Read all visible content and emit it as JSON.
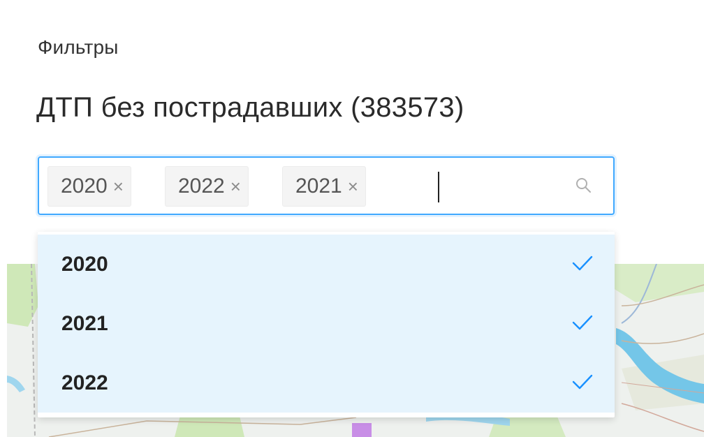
{
  "filters": {
    "title": "Фильтры",
    "layer_title": "ДТП без пострадавших (383573)"
  },
  "select": {
    "tags": [
      {
        "label": "2020",
        "close": "×"
      },
      {
        "label": "2022",
        "close": "×"
      },
      {
        "label": "2021",
        "close": "×"
      }
    ],
    "search_icon": "search-icon"
  },
  "dropdown": {
    "options": [
      {
        "label": "2020",
        "selected": true,
        "icon": "check-icon"
      },
      {
        "label": "2021",
        "selected": true,
        "icon": "check-icon"
      },
      {
        "label": "2022",
        "selected": true,
        "icon": "check-icon"
      }
    ]
  },
  "colors": {
    "accent": "#1890ff",
    "option_bg": "#e6f4fd",
    "tag_bg": "#f4f4f4"
  }
}
